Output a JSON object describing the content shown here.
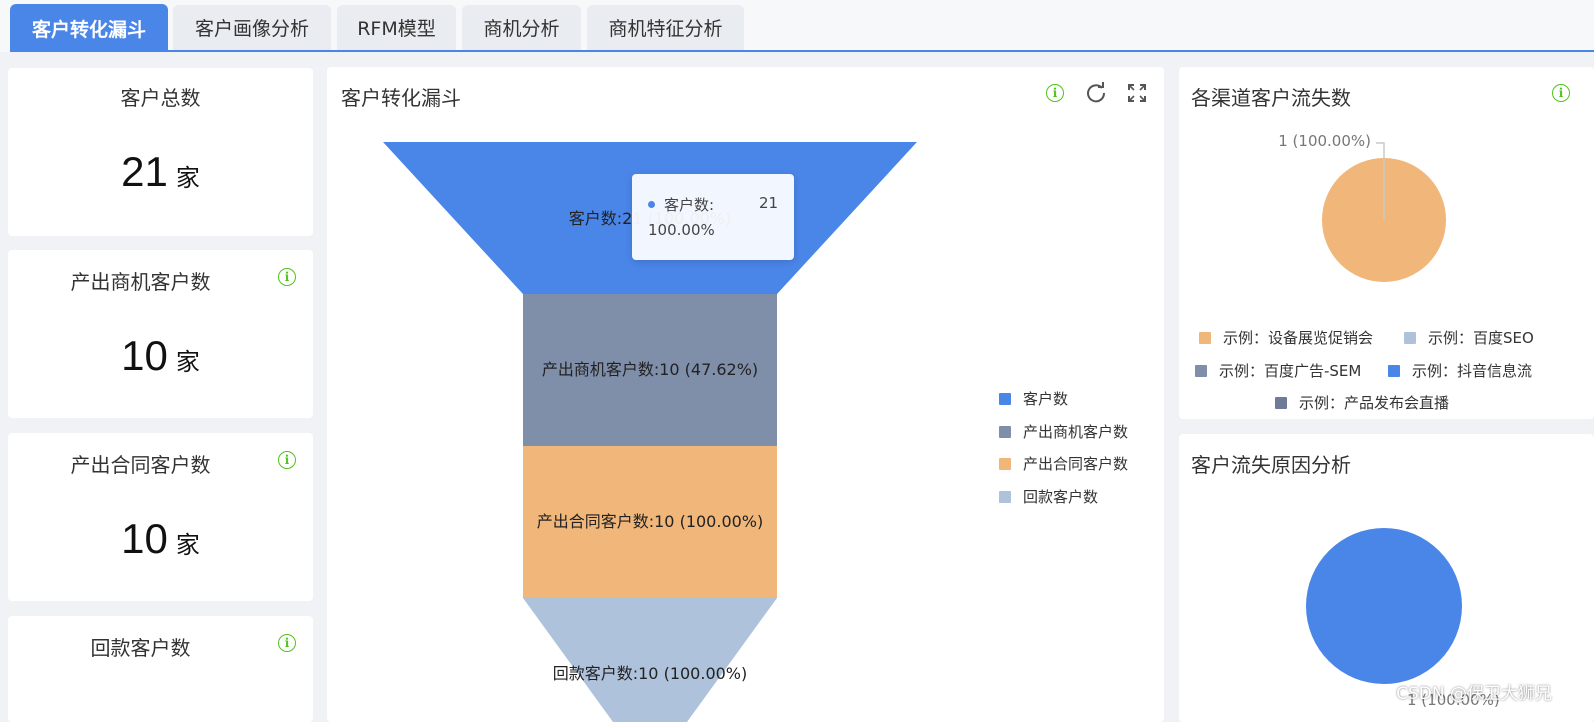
{
  "tabs": [
    "客户转化漏斗",
    "客户画像分析",
    "RFM模型",
    "商机分析",
    "商机特征分析"
  ],
  "kpis": [
    {
      "title": "客户总数",
      "value": "21",
      "unit": "家",
      "has_info": false
    },
    {
      "title": "产出商机客户数",
      "value": "10",
      "unit": "家",
      "has_info": true
    },
    {
      "title": "产出合同客户数",
      "value": "10",
      "unit": "家",
      "has_info": true
    },
    {
      "title": "回款客户数",
      "value": "",
      "unit": "",
      "has_info": true
    }
  ],
  "funnel": {
    "title": "客户转化漏斗",
    "labels": [
      "客户数:21 (100.00%)",
      "产出商机客户数:10 (47.62%)",
      "产出合同客户数:10 (100.00%)",
      "回款客户数:10 (100.00%)"
    ],
    "legend": [
      "客户数",
      "产出商机客户数",
      "产出合同客户数",
      "回款客户数"
    ],
    "tooltip": {
      "name": "客户数:",
      "value": "21",
      "percent": "100.00%"
    }
  },
  "channel_loss": {
    "title": "各渠道客户流失数",
    "label": "1 (100.00%)",
    "legend": [
      "示例：设备展览促销会",
      "示例：百度SEO",
      "示例：百度广告-SEM",
      "示例：抖音信息流",
      "示例：产品发布会直播"
    ]
  },
  "loss_reason": {
    "title": "客户流失原因分析",
    "label": "1 (100.00%)"
  },
  "watermark": "CSDN @保卫大狮兄",
  "colors": {
    "accent": "#4a86e8",
    "blue": "#4a86e8",
    "slate": "#7f8ea9",
    "orange": "#f0b67a",
    "lightblue": "#afc2dc",
    "green": "#52c41a"
  },
  "chart_data": [
    {
      "type": "funnel",
      "categories": [
        "客户数",
        "产出商机客户数",
        "产出合同客户数",
        "回款客户数"
      ],
      "values": [
        21,
        10,
        10,
        10
      ],
      "percents": [
        100.0,
        47.62,
        100.0,
        100.0
      ]
    },
    {
      "type": "pie",
      "labels": [
        "示例：设备展览促销会"
      ],
      "values": [
        1
      ],
      "percents": [
        100.0
      ]
    },
    {
      "type": "pie",
      "values": [
        1
      ],
      "percents": [
        100.0
      ]
    }
  ]
}
